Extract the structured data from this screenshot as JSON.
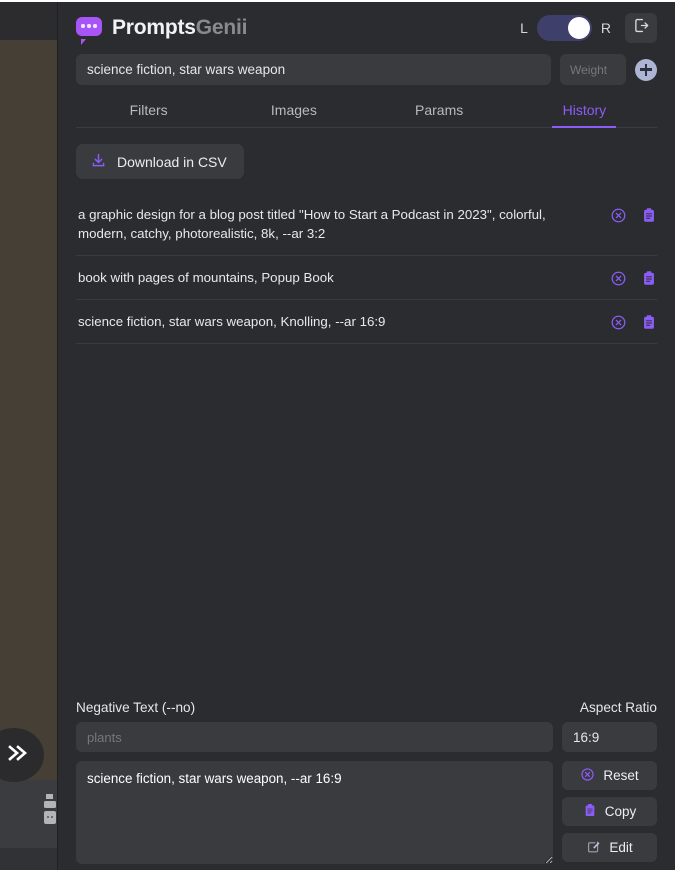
{
  "app": {
    "brand_primary": "Prompts",
    "brand_secondary": "Genii",
    "accent_color": "#8b5cf6",
    "logo_icon": "speech-bubble-dots-icon"
  },
  "header": {
    "toggle_left_label": "L",
    "toggle_right_label": "R",
    "toggle_state": "right",
    "logout_icon": "logout-icon"
  },
  "search": {
    "value": "science fiction, star wars weapon",
    "weight_placeholder": "Weight",
    "weight_value": "",
    "add_icon": "plus-circle-icon"
  },
  "tabs": [
    {
      "label": "Filters",
      "active": false
    },
    {
      "label": "Images",
      "active": false
    },
    {
      "label": "Params",
      "active": false
    },
    {
      "label": "History",
      "active": true
    }
  ],
  "toolbar": {
    "download_label": "Download in CSV",
    "download_icon": "download-icon"
  },
  "history": {
    "reset_icon": "reset-circle-icon",
    "copy_icon": "clipboard-icon",
    "items": [
      {
        "text": "a graphic design for a blog post titled \"How to Start a Podcast in 2023\", colorful, modern, catchy, photorealistic, 8k, --ar 3:2"
      },
      {
        "text": "book with pages of mountains, Popup Book"
      },
      {
        "text": "science fiction, star wars weapon, Knolling, --ar 16:9"
      }
    ]
  },
  "bottom": {
    "negative_label": "Negative Text (--no)",
    "negative_placeholder": "plants",
    "negative_value": "",
    "aspect_label": "Aspect Ratio",
    "aspect_value": "16:9",
    "prompt_value": "science fiction, star wars weapon, --ar 16:9",
    "actions": [
      {
        "label": "Reset",
        "icon": "reset-circle-icon"
      },
      {
        "label": "Copy",
        "icon": "clipboard-icon"
      },
      {
        "label": "Edit",
        "icon": "edit-pencil-icon"
      }
    ]
  },
  "sidebar": {
    "collapse_icon": "double-chevron-right-icon"
  }
}
